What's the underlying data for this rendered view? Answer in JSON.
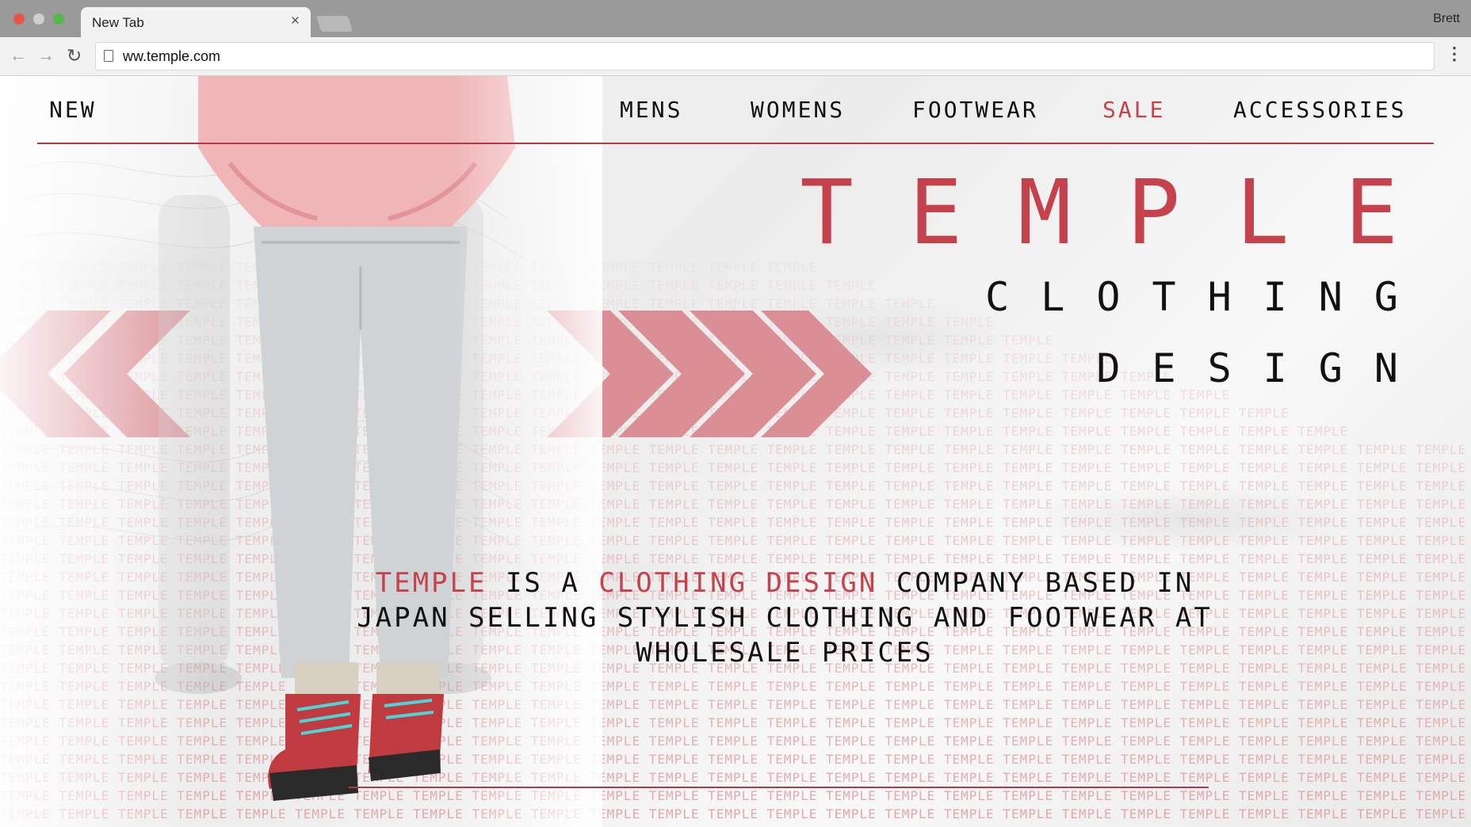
{
  "browser": {
    "tab_title": "New Tab",
    "tab_close": "×",
    "user_name": "Brett",
    "url": "ww.temple.com",
    "back_icon": "←",
    "forward_icon": "→",
    "reload_icon": "↻",
    "menu_icon": "⋮"
  },
  "nav": {
    "items": [
      {
        "label": "NEW",
        "highlight": false
      },
      {
        "label": "MENS",
        "highlight": false
      },
      {
        "label": "WOMENS",
        "highlight": false
      },
      {
        "label": "FOOTWEAR",
        "highlight": false
      },
      {
        "label": "SALE",
        "highlight": true
      },
      {
        "label": "ACCESSORIES",
        "highlight": false
      }
    ]
  },
  "hero": {
    "brand": "TEMPLE",
    "subtitle_line1": "CLOTHING",
    "subtitle_line2": "DESIGN",
    "description": {
      "brand_word": "TEMPLE",
      "text_1": " IS A ",
      "highlight": "CLOTHING DESIGN",
      "text_2": " COMPANY BASED IN JAPAN SELLING STYLISH CLOTHING AND FOOTWEAR AT WHOLESALE PRICES"
    },
    "pattern_word": "TEMPLE"
  },
  "colors": {
    "accent": "#c5424d",
    "arrow": "#d9878e",
    "text": "#111111"
  }
}
